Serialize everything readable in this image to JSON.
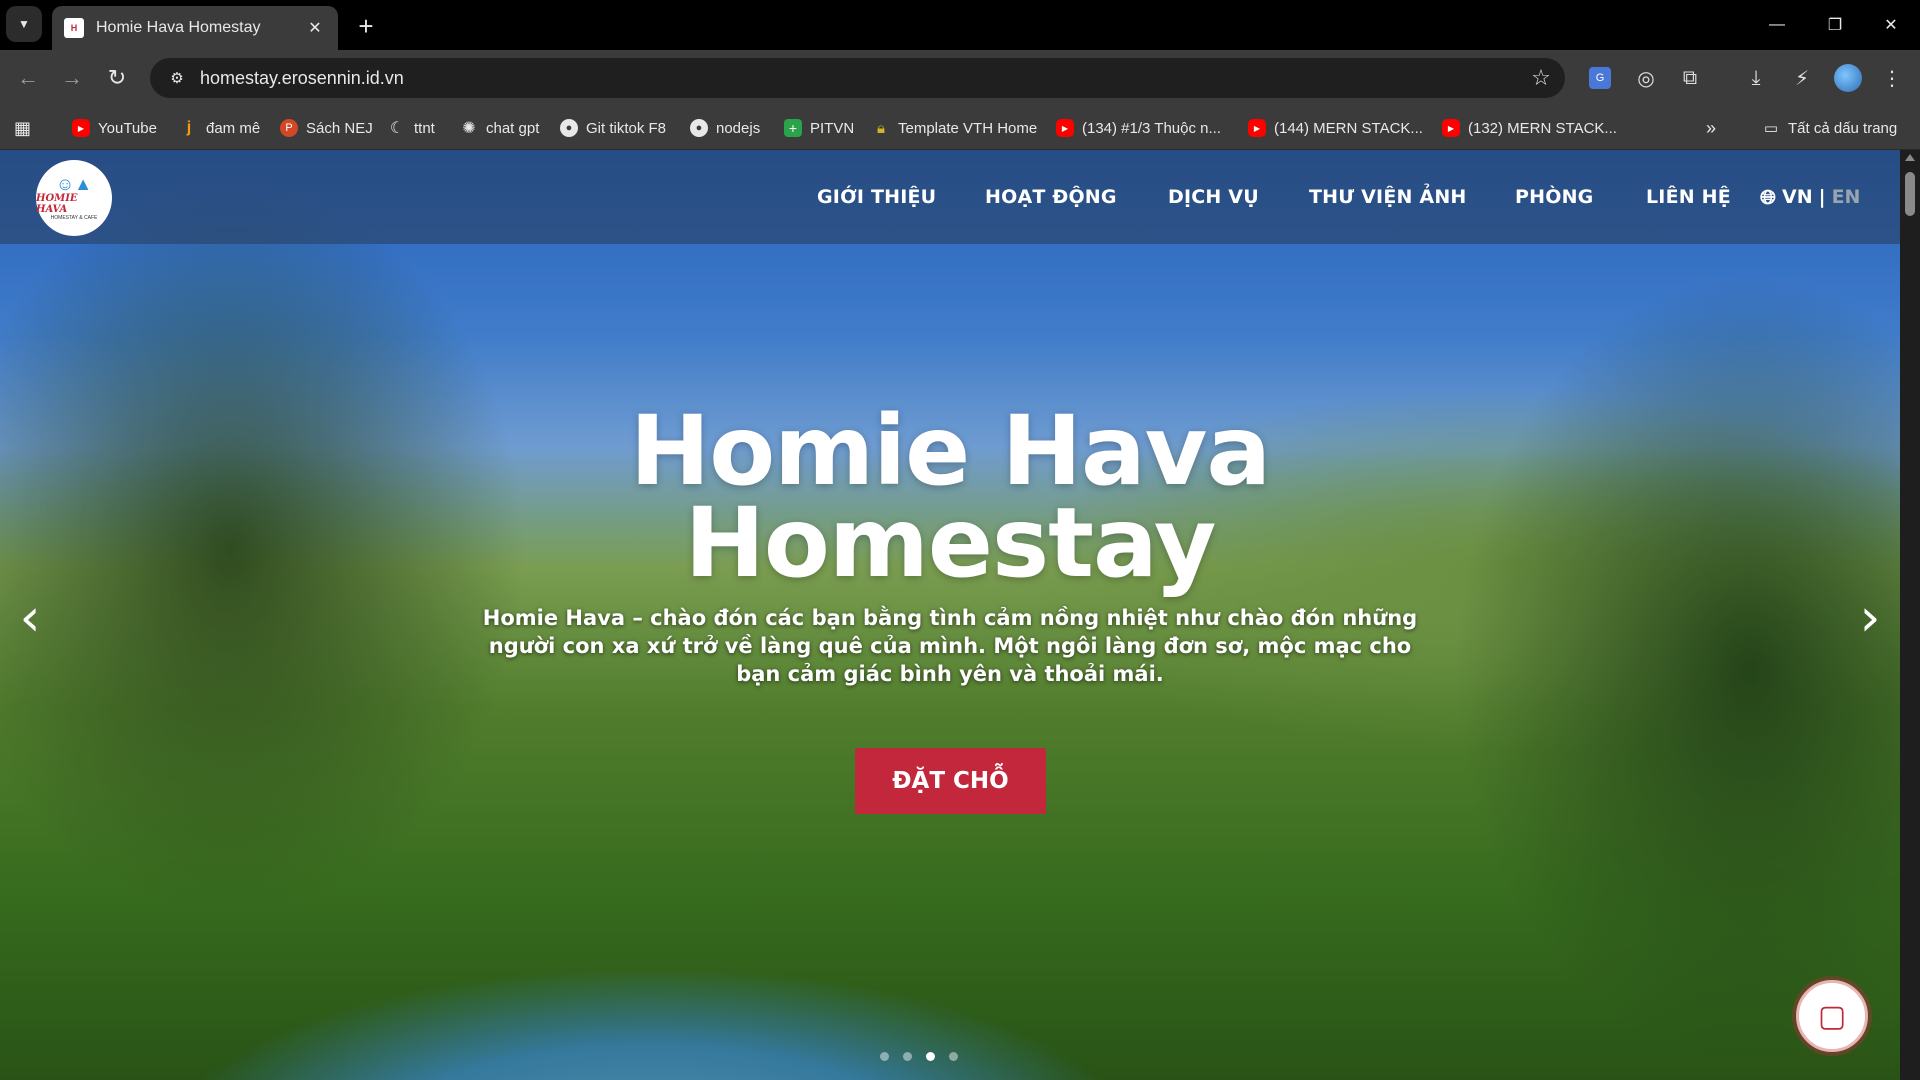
{
  "browser": {
    "tab_title": "Homie Hava Homestay",
    "tab_close": "✕",
    "new_tab": "+",
    "url": "homestay.erosennin.id.vn",
    "window_controls": {
      "minimize": "—",
      "restore": "❐",
      "close": "✕"
    }
  },
  "bookmarks": [
    {
      "label": "YouTube",
      "icon": "youtube-icon"
    },
    {
      "label": "đam mê",
      "icon": "j-icon"
    },
    {
      "label": "Sách NEJ",
      "icon": "powerpoint-icon"
    },
    {
      "label": "ttnt",
      "icon": "moon-icon"
    },
    {
      "label": "chat gpt",
      "icon": "openai-icon"
    },
    {
      "label": "Git tiktok F8",
      "icon": "github-icon"
    },
    {
      "label": "nodejs",
      "icon": "github-icon"
    },
    {
      "label": "PITVN",
      "icon": "plus-icon"
    },
    {
      "label": "Template VTH Home",
      "icon": "lock-icon"
    },
    {
      "label": "(134) #1/3 Thuộc n...",
      "icon": "youtube-icon"
    },
    {
      "label": "(144) MERN STACK...",
      "icon": "youtube-icon"
    },
    {
      "label": "(132) MERN STACK...",
      "icon": "youtube-icon"
    }
  ],
  "bookmarks_overflow": "»",
  "all_bookmarks": "Tất cả dấu trang",
  "site": {
    "logo": {
      "name": "HOMIE HAVA",
      "sub": "HOMESTAY & CAFE"
    },
    "menu": [
      "GIỚI THIỆU",
      "HOẠT ĐỘNG",
      "DỊCH VỤ",
      "THƯ VIỆN ẢNH",
      "PHÒNG",
      "LIÊN HỆ"
    ],
    "lang": {
      "vn": "VN",
      "sep": "|",
      "en": "EN"
    },
    "hero": {
      "title": "Homie Hava Homestay",
      "description": "Homie Hava – chào đón các bạn bằng tình cảm nồng nhiệt như chào đón những người con xa xứ trở về làng quê của mình. Một ngôi làng đơn sơ, mộc mạc cho bạn cảm giác bình yên và thoải mái.",
      "cta": "ĐẶT CHỖ",
      "prev": "‹",
      "next": "›",
      "slides": 4,
      "active_slide": 3
    }
  },
  "colors": {
    "accent": "#c2273b",
    "chrome_bg": "#3b3b3b",
    "tabstrip_bg": "#000000"
  }
}
